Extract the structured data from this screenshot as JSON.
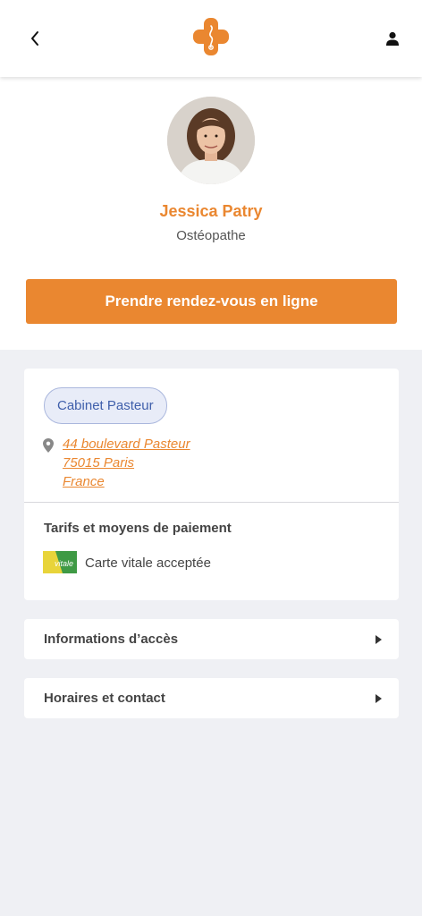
{
  "header": {
    "back_icon": "chevron-left-icon",
    "logo": "medical-cross-logo",
    "user_icon": "user-icon",
    "brand_color": "#ea8730"
  },
  "profile": {
    "name": "Jessica Patry",
    "specialty": "Ostéopathe",
    "cta_label": "Prendre rendez-vous en ligne"
  },
  "location": {
    "cabinet": "Cabinet Pasteur",
    "address_line1": "44 boulevard Pasteur",
    "address_line2": "75015 Paris",
    "address_line3": "France",
    "pin_icon": "map-pin-icon"
  },
  "payment": {
    "title": "Tarifs et moyens de paiement",
    "vitale_label": "Carte vitale acceptée",
    "vitale_logo_text": "vitale"
  },
  "sections": [
    {
      "label": "Informations d’accès",
      "icon": "caret-right-icon"
    },
    {
      "label": "Horaires et contact",
      "icon": "caret-right-icon"
    }
  ]
}
